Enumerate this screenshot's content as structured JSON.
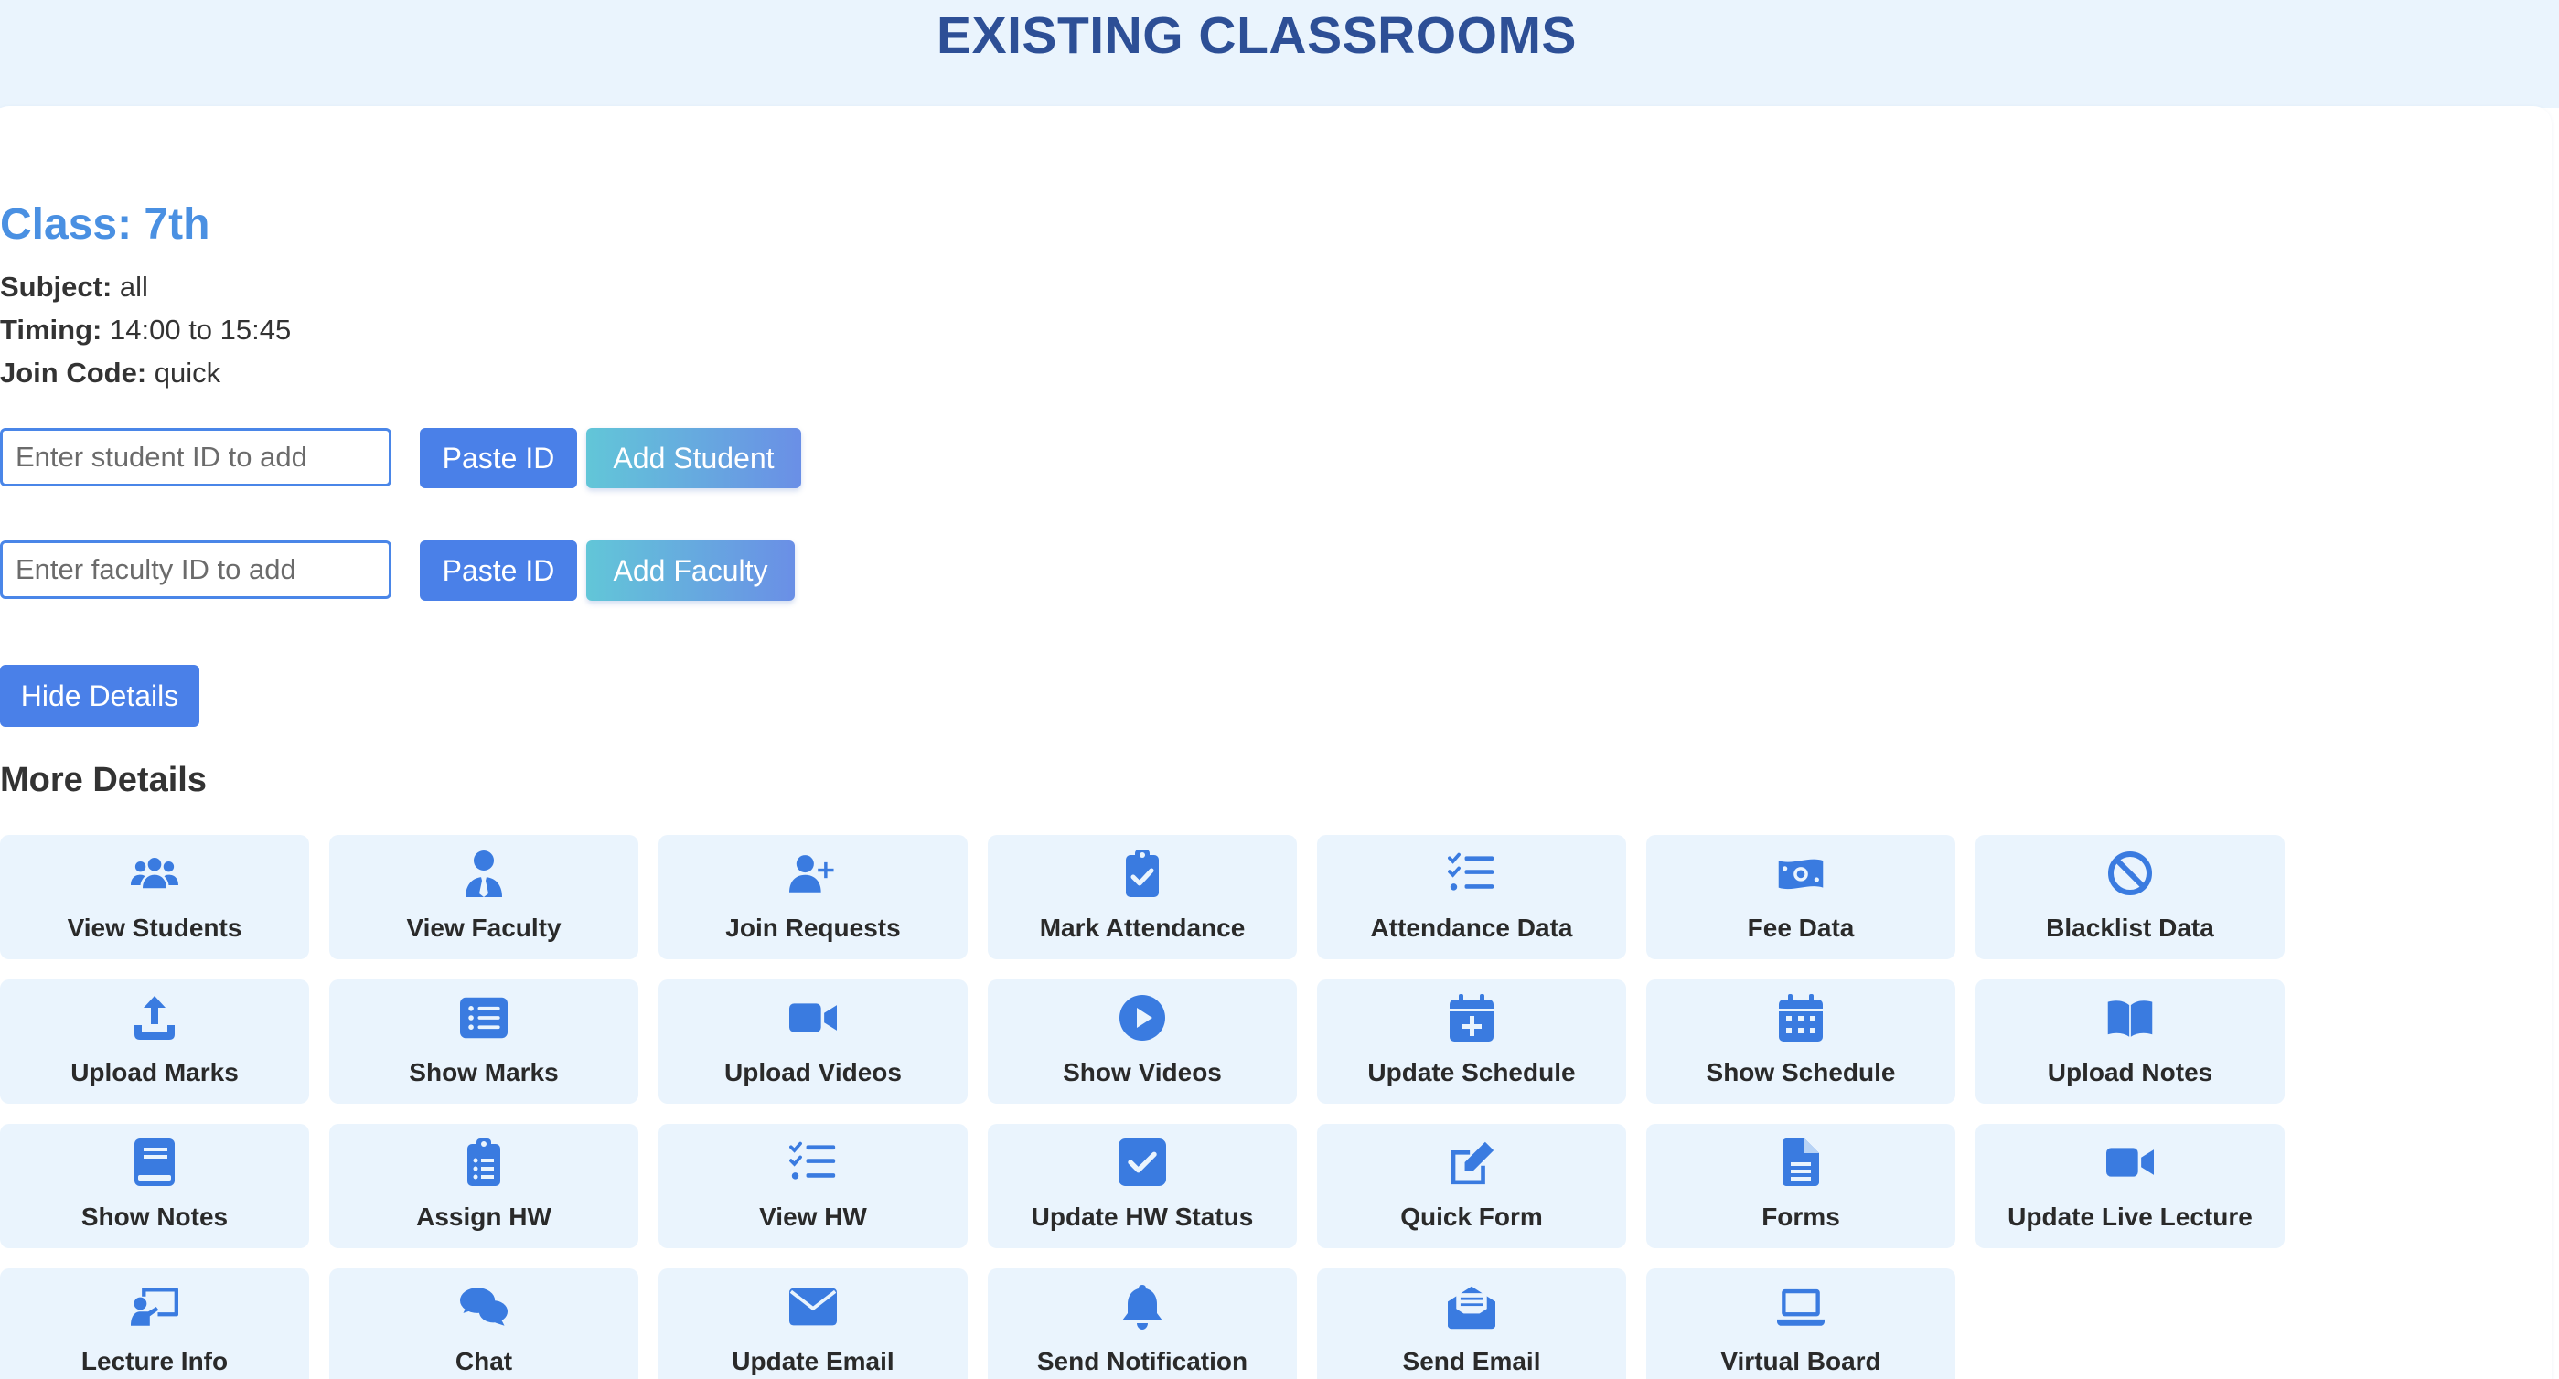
{
  "header": {
    "title": "EXISTING CLASSROOMS"
  },
  "classroom": {
    "title": "Class: 7th",
    "subject_label": "Subject:",
    "subject_value": "all",
    "timing_label": "Timing:",
    "timing_value": "14:00 to 15:45",
    "join_code_label": "Join Code:",
    "join_code_value": "quick"
  },
  "student_form": {
    "placeholder": "Enter student ID to add",
    "value": "",
    "paste_label": "Paste ID",
    "add_label": "Add Student"
  },
  "faculty_form": {
    "placeholder": "Enter faculty ID to add",
    "value": "",
    "paste_label": "Paste ID",
    "add_label": "Add Faculty"
  },
  "hide_details_label": "Hide Details",
  "more_details": {
    "title": "More Details",
    "items": [
      {
        "label": "View Students",
        "icon": "users-icon"
      },
      {
        "label": "View Faculty",
        "icon": "user-tie-icon"
      },
      {
        "label": "Join Requests",
        "icon": "user-plus-icon"
      },
      {
        "label": "Mark Attendance",
        "icon": "clipboard-check-icon"
      },
      {
        "label": "Attendance Data",
        "icon": "list-check-icon"
      },
      {
        "label": "Fee Data",
        "icon": "money-bill-icon"
      },
      {
        "label": "Blacklist Data",
        "icon": "ban-icon"
      },
      {
        "label": "Upload Marks",
        "icon": "upload-icon"
      },
      {
        "label": "Show Marks",
        "icon": "list-alt-icon"
      },
      {
        "label": "Upload Videos",
        "icon": "video-icon"
      },
      {
        "label": "Show Videos",
        "icon": "play-circle-icon"
      },
      {
        "label": "Update Schedule",
        "icon": "calendar-plus-icon"
      },
      {
        "label": "Show Schedule",
        "icon": "calendar-icon"
      },
      {
        "label": "Upload Notes",
        "icon": "book-open-icon"
      },
      {
        "label": "Show Notes",
        "icon": "book-icon"
      },
      {
        "label": "Assign HW",
        "icon": "clipboard-list-icon"
      },
      {
        "label": "View HW",
        "icon": "list-check-icon"
      },
      {
        "label": "Update HW Status",
        "icon": "square-check-icon"
      },
      {
        "label": "Quick Form",
        "icon": "edit-icon"
      },
      {
        "label": "Forms",
        "icon": "file-alt-icon"
      },
      {
        "label": "Update Live Lecture",
        "icon": "video-icon"
      },
      {
        "label": "Lecture Info",
        "icon": "chalkboard-teacher-icon"
      },
      {
        "label": "Chat",
        "icon": "comments-icon"
      },
      {
        "label": "Update Email",
        "icon": "envelope-icon"
      },
      {
        "label": "Send Notification",
        "icon": "bell-icon"
      },
      {
        "label": "Send Email",
        "icon": "envelope-open-text-icon"
      },
      {
        "label": "Virtual Board",
        "icon": "laptop-icon"
      }
    ]
  },
  "colors": {
    "accent": "#4a80e8",
    "icon": "#3a7be0",
    "title": "#2d4f96",
    "class_title": "#4a90e2",
    "tile_bg": "#eaf4fd"
  }
}
